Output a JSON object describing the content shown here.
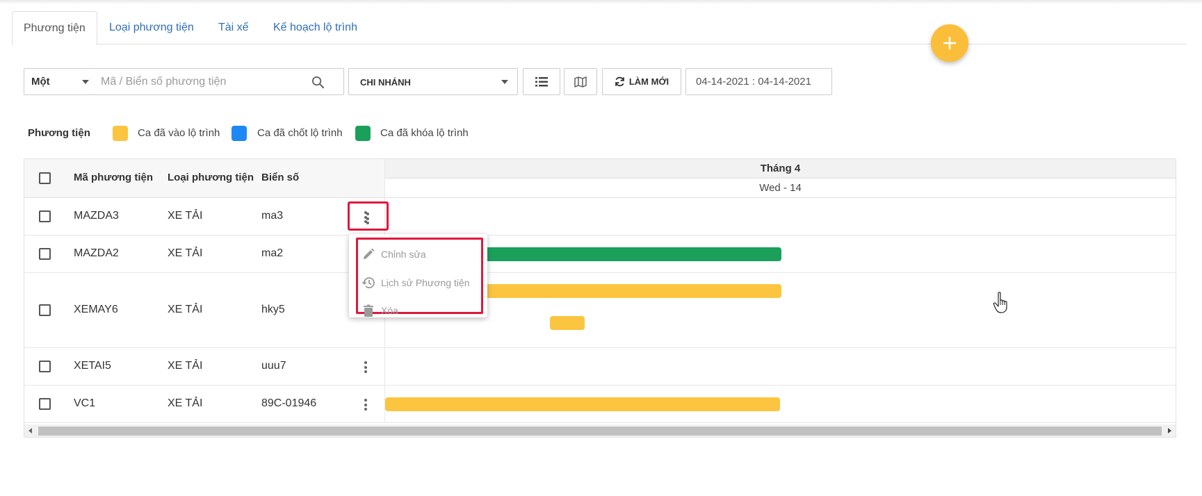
{
  "tabs": [
    {
      "label": "Phương tiện",
      "active": true
    },
    {
      "label": "Loại phương tiện",
      "active": false
    },
    {
      "label": "Tài xế",
      "active": false
    },
    {
      "label": "Kế hoạch lộ trình",
      "active": false
    }
  ],
  "toolbar": {
    "mode_value": "Một",
    "search_placeholder": "Mã / Biển số phương tiện",
    "search_value": "",
    "branch_value": "CHI NHÁNH",
    "refresh_label": "LÀM MỚI",
    "date_range": "04-14-2021 : 04-14-2021"
  },
  "legend": {
    "title": "Phương tiện",
    "items": [
      {
        "label": "Ca đã vào lộ trình",
        "color": "#fbc540"
      },
      {
        "label": "Ca đã chốt lộ trình",
        "color": "#1e88f5"
      },
      {
        "label": "Ca đã khóa lộ trình",
        "color": "#1aa05a"
      }
    ]
  },
  "table": {
    "headers": {
      "code": "Mã phương tiện",
      "type": "Loại phương tiện",
      "plate": "Biển số"
    },
    "timeline_month": "Tháng 4",
    "timeline_day": "Wed - 14",
    "rows": [
      {
        "code": "MAZDA3",
        "type": "XE TẢI",
        "plate": "ma3"
      },
      {
        "code": "MAZDA2",
        "type": "XE TẢI",
        "plate": "ma2"
      },
      {
        "code": "XEMAY6",
        "type": "XE TẢI",
        "plate": "hky5"
      },
      {
        "code": "XETAI5",
        "type": "XE TẢI",
        "plate": "uuu7"
      },
      {
        "code": "VC1",
        "type": "XE TẢI",
        "plate": "89C-01946"
      }
    ]
  },
  "row_menu": {
    "items": [
      {
        "label": "Chỉnh sửa",
        "icon": "pencil-icon"
      },
      {
        "label": "Lịch sử Phương tiện",
        "icon": "history-icon"
      },
      {
        "label": "Xóa",
        "icon": "trash-icon"
      }
    ]
  },
  "colors": {
    "accent": "#fbbe3a",
    "link": "#2f6fb6",
    "highlight": "#e0173c"
  }
}
